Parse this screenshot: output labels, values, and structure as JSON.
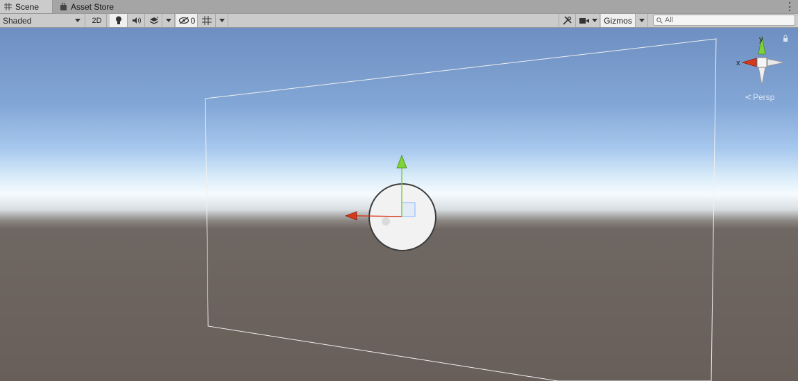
{
  "tabs": [
    {
      "label": "Scene",
      "icon": "grid-icon",
      "active": true
    },
    {
      "label": "Asset Store",
      "icon": "bag-icon",
      "active": false
    }
  ],
  "toolbar": {
    "draw_mode": "Shaded",
    "mode_2d": "2D",
    "hidden_count": "0",
    "gizmos_label": "Gizmos",
    "search_placeholder": "All"
  },
  "scene_gizmo": {
    "y_label": "y",
    "x_label": "x",
    "projection_label": "Persp"
  },
  "colors": {
    "x_axis": "#d63a1c",
    "y_axis": "#7ed23a",
    "selection_outline": "#f0f0f0"
  }
}
